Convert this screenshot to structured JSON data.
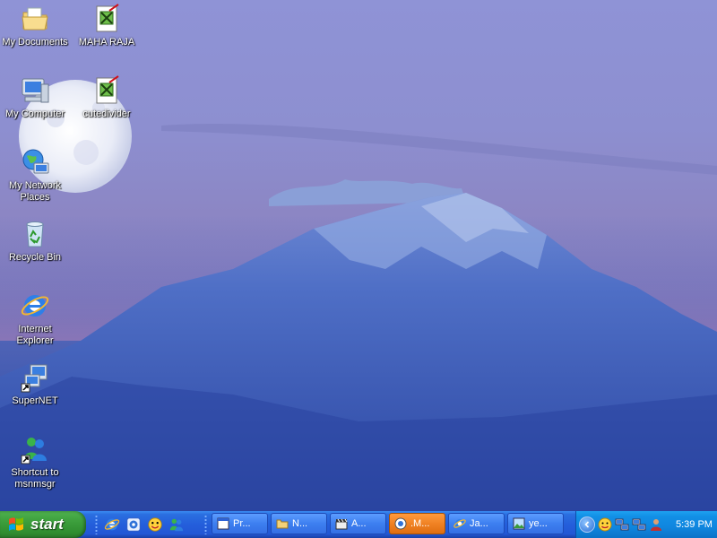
{
  "desktop": {
    "icons": [
      {
        "label": "My Documents",
        "icon": "folder-documents-icon"
      },
      {
        "label": "MAHA RAJA",
        "icon": "document-shortcut-icon"
      },
      {
        "label": "My Computer",
        "icon": "computer-icon"
      },
      {
        "label": "cutedivider",
        "icon": "document-shortcut-icon"
      },
      {
        "label": "My Network Places",
        "icon": "network-places-icon"
      },
      {
        "label": "Recycle Bin",
        "icon": "recycle-bin-icon"
      },
      {
        "label": "Internet Explorer",
        "icon": "ie-icon"
      },
      {
        "label": "SuperNET",
        "icon": "supernet-icon"
      },
      {
        "label": "Shortcut to msnmsgr",
        "icon": "msn-messenger-icon"
      }
    ]
  },
  "taskbar": {
    "start_label": "start",
    "quick_launch": [
      "internet-explorer-icon",
      "messenger-icon",
      "yahoo-messenger-icon",
      "msn-icon"
    ],
    "tasks": [
      {
        "label": "Pr...",
        "icon": "window-icon",
        "active": false
      },
      {
        "label": "N...",
        "icon": "folder-icon",
        "active": false
      },
      {
        "label": "A...",
        "icon": "clapper-icon",
        "active": false
      },
      {
        "label": ".M...",
        "icon": "messenger-icon",
        "active": true
      },
      {
        "label": "Ja...",
        "icon": "ie-icon",
        "active": false
      },
      {
        "label": "ye...",
        "icon": "image-icon",
        "active": false
      }
    ],
    "tray": {
      "icons": [
        "yahoo-icon",
        "network-icon",
        "network-icon-2",
        "user-icon"
      ],
      "clock": "5:39 PM"
    }
  },
  "colors": {
    "taskbar": "#245edb",
    "start_button": "#3c9e3c",
    "active_task": "#f08224",
    "tray": "#0f86df"
  }
}
